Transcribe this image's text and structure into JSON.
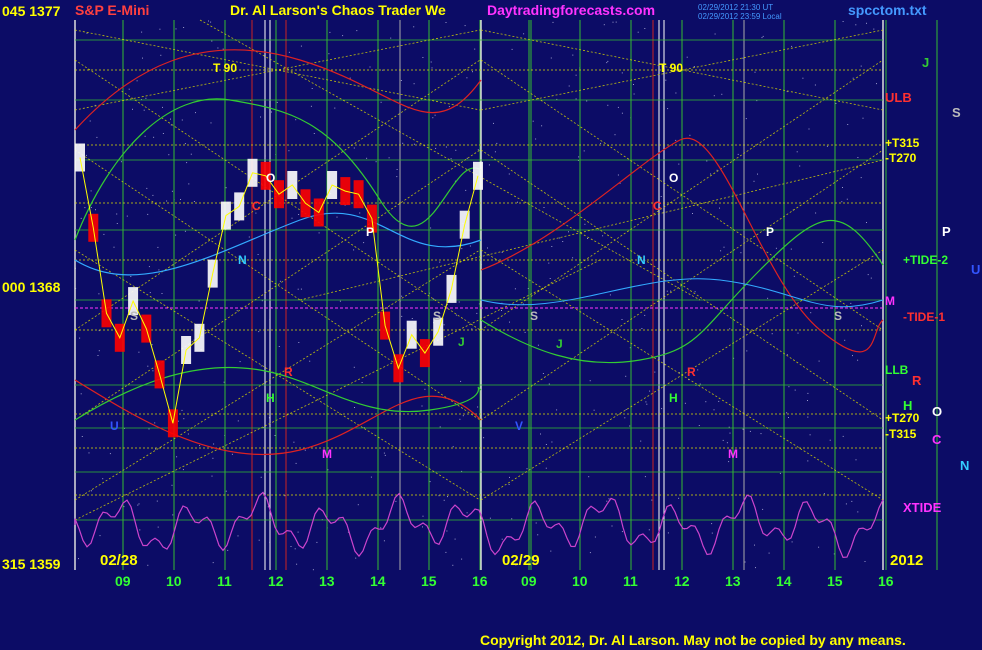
{
  "header": {
    "left_values": "045 1377",
    "symbol": "S&P E-Mini",
    "title": "Dr. Al Larson's Chaos Trader We",
    "site": "Daytradingforecasts.com",
    "timestamp1": "02/29/2012 21:30 UT",
    "timestamp2": "02/29/2012 23:59 Local",
    "filename": "spcctom.txt"
  },
  "y_axis": {
    "top": "045 1377",
    "mid": "000 1368",
    "bottom": "315 1359"
  },
  "footer": {
    "date_left": "02/28",
    "date_mid": "02/29",
    "year": "2012",
    "copyright": "Copyright 2012, Dr. Al Larson. May not be copied by any means."
  },
  "side_labels": {
    "J": "J",
    "ULB": "ULB",
    "S": "S",
    "U": "U",
    "p315": "+T315",
    "m270": "-T270",
    "P": "P",
    "tide2": "+TIDE-2",
    "M": "M",
    "tide1": "-TIDE-1",
    "LLB": "LLB",
    "R": "R",
    "H": "H",
    "p270": "+T270",
    "O": "O",
    "m315": "-T315",
    "C": "C",
    "N": "N",
    "xtide": "XTIDE"
  },
  "colors": {
    "background": "#0c0c66",
    "price_up": "#ffffff",
    "price_down": "#ff0000",
    "upper_band": "#dd2222",
    "green_line": "#33cc33",
    "cyan_line": "#33aaff",
    "tide": "#cc44cc",
    "grid_yellow": "#dddd00",
    "grid_green": "#33bb33",
    "accent_yellow": "#ffff00",
    "accent_magenta": "#ff33ff"
  },
  "chart_data": {
    "type": "line",
    "title": "S&P E-Mini",
    "ylim": [
      1359,
      1377
    ],
    "x_ticks": [
      "09",
      "10",
      "11",
      "12",
      "13",
      "14",
      "15",
      "16",
      "09",
      "10",
      "11",
      "12",
      "13",
      "14",
      "15",
      "16"
    ],
    "dates": [
      "02/28",
      "02/29"
    ],
    "markers": [
      "T 90",
      "T 90",
      "O",
      "O",
      "P",
      "P",
      "N",
      "N",
      "S",
      "S",
      "S",
      "S",
      "J",
      "J",
      "R",
      "R",
      "H",
      "H",
      "M",
      "M",
      "C",
      "C",
      "U",
      "V"
    ],
    "series": [
      {
        "values": [
          1372.5,
          1370.2,
          1367.4,
          1366.6,
          1367.8,
          1366.9,
          1365.4,
          1363.8,
          1366.2,
          1366.6,
          1368.7,
          1370.6,
          1370.9,
          1372.0,
          1371.9,
          1371.3,
          1371.6,
          1371.0,
          1370.7,
          1371.6,
          1371.4,
          1371.3,
          1370.5,
          1367.0,
          1365.6,
          1366.7,
          1366.1,
          1366.8,
          1368.2,
          1370.3,
          1371.9
        ]
      }
    ]
  }
}
